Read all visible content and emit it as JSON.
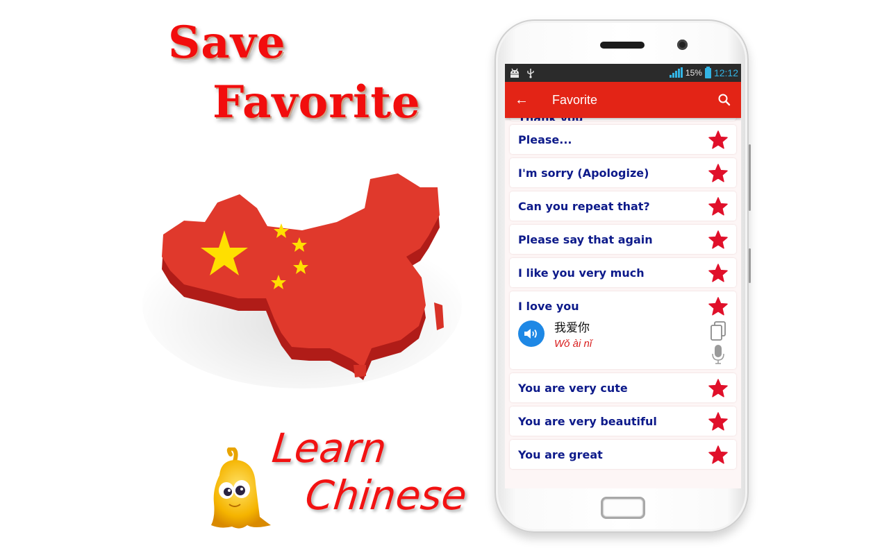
{
  "promo": {
    "headline_line1": "Save",
    "headline_line2": "Favorite",
    "tagline_line1": "Learn",
    "tagline_line2": "Chinese"
  },
  "status_bar": {
    "battery_percent": "15%",
    "time": "12:12",
    "left_icons": [
      "android-debug-icon",
      "usb-icon"
    ],
    "right_icons": [
      "signal-icon",
      "battery-charging-icon"
    ]
  },
  "app_bar": {
    "back_icon": "arrow-left-icon",
    "title": "Favorite",
    "search_icon": "search-icon",
    "color": "#e32416"
  },
  "favorites": [
    {
      "phrase": "Thank you",
      "starred": true
    },
    {
      "phrase": "Please...",
      "starred": true
    },
    {
      "phrase": "I'm sorry (Apologize)",
      "starred": true
    },
    {
      "phrase": "Can you repeat that?",
      "starred": true
    },
    {
      "phrase": "Please say that again",
      "starred": true
    },
    {
      "phrase": "I like you very much",
      "starred": true
    },
    {
      "phrase": "I love you",
      "starred": true,
      "expanded": true,
      "chinese": "我爱你",
      "pinyin": "Wǒ ài nǐ"
    },
    {
      "phrase": "You are very cute",
      "starred": true
    },
    {
      "phrase": "You are very beautiful",
      "starred": true
    },
    {
      "phrase": "You are great",
      "starred": true
    }
  ],
  "colors": {
    "phrase_text": "#0d1a8a",
    "star": "#e0102a",
    "pinyin": "#d81d1d",
    "sound_button": "#1e88e5"
  }
}
